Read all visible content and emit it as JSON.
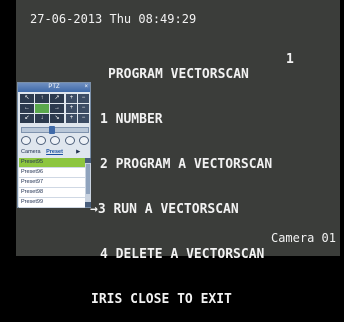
{
  "osd": {
    "timestamp": "27-06-2013 Thu 08:49:29",
    "camera": "Camera 01"
  },
  "menu": {
    "title": "PROGRAM VECTORSCAN",
    "lines": [
      "1 NUMBER",
      "2 PROGRAM A VECTORSCAN",
      "→3 RUN A VECTORSCAN",
      "4 DELETE A VECTORSCAN",
      "IRIS CLOSE TO EXIT"
    ],
    "number_value": "1"
  },
  "ptz": {
    "title": "PTZ",
    "close_glyph": "×",
    "direction_glyphs": [
      "↖",
      "↑",
      "↗",
      "←",
      "",
      "→",
      "↙",
      "↓",
      "↘"
    ],
    "side_glyphs": [
      "+",
      "−",
      "+",
      "−",
      "+",
      "−"
    ],
    "speed_fraction": 0.45,
    "icon_names": [
      "focus-icon",
      "zoom-icon",
      "iris-icon",
      "light-icon",
      "wiper-icon"
    ],
    "tabs": [
      "Camera",
      "Preset",
      "▶"
    ],
    "active_tab": "Preset",
    "presets": [
      "Preset95",
      "Preset96",
      "Preset97",
      "Preset98",
      "Preset99"
    ],
    "selected_preset": "Preset95"
  }
}
